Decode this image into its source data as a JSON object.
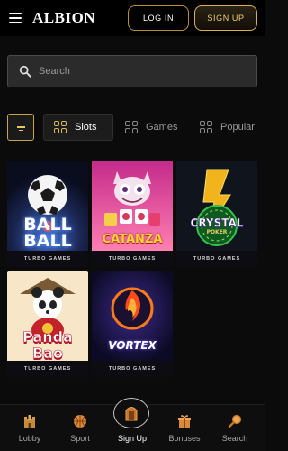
{
  "header": {
    "logo": "ALBION",
    "login_label": "LOG IN",
    "signup_label": "SIGN UP"
  },
  "search": {
    "placeholder": "Search"
  },
  "categories": [
    {
      "label": "Slots",
      "active": true
    },
    {
      "label": "Games",
      "active": false
    },
    {
      "label": "Popular",
      "active": false
    }
  ],
  "games": [
    {
      "title_top": "BALL",
      "title_amp": "&",
      "title_bottom": "BALL",
      "provider": "TURBO GAMES"
    },
    {
      "title": "CATANZA",
      "provider": "TURBO GAMES"
    },
    {
      "title": "CRYSTAL",
      "sub": "POKER",
      "provider": "TURBO GAMES"
    },
    {
      "title_top": "Panda",
      "title_bottom": "Bao",
      "provider": "TURBO GAMES"
    },
    {
      "title": "VORTEX",
      "provider": "TURBO GAMES"
    }
  ],
  "bottom_nav": [
    {
      "label": "Lobby",
      "icon": "castle-icon"
    },
    {
      "label": "Sport",
      "icon": "ball-icon"
    },
    {
      "label": "Sign Up",
      "icon": "door-icon"
    },
    {
      "label": "Bonuses",
      "icon": "gift-icon"
    },
    {
      "label": "Search",
      "icon": "magnifier-icon"
    }
  ],
  "colors": {
    "gold": "#c9a441",
    "background": "#0b0b0b"
  }
}
